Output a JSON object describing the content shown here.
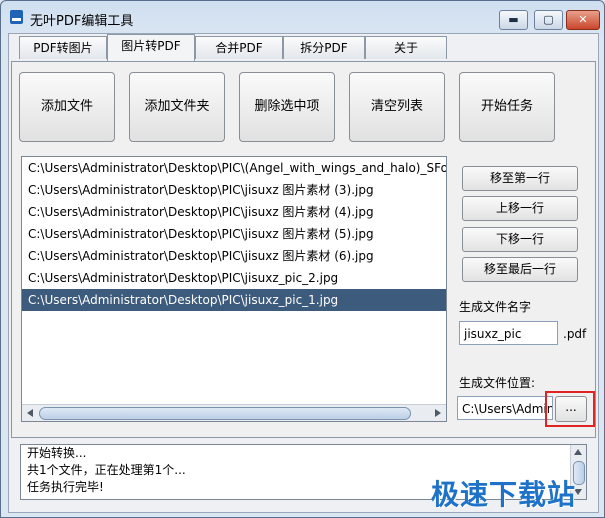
{
  "window": {
    "title": "无叶PDF编辑工具",
    "controls": {
      "minimize": "▬",
      "maximize": "▢",
      "close": "✕"
    }
  },
  "tabs": [
    {
      "label": "PDF转图片"
    },
    {
      "label": "图片转PDF",
      "active": true
    },
    {
      "label": "合并PDF"
    },
    {
      "label": "拆分PDF"
    },
    {
      "label": "关于"
    }
  ],
  "actions": {
    "add_file": "添加文件",
    "add_folder": "添加文件夹",
    "delete_selected": "删除选中项",
    "clear_list": "清空列表",
    "start_task": "开始任务"
  },
  "file_list": [
    "C:\\Users\\Administrator\\Desktop\\PIC\\(Angel_with_wings_and_halo)_SFont.C",
    "C:\\Users\\Administrator\\Desktop\\PIC\\jisuxz 图片素材 (3).jpg",
    "C:\\Users\\Administrator\\Desktop\\PIC\\jisuxz 图片素材 (4).jpg",
    "C:\\Users\\Administrator\\Desktop\\PIC\\jisuxz 图片素材 (5).jpg",
    "C:\\Users\\Administrator\\Desktop\\PIC\\jisuxz 图片素材 (6).jpg",
    "C:\\Users\\Administrator\\Desktop\\PIC\\jisuxz_pic_2.jpg",
    "C:\\Users\\Administrator\\Desktop\\PIC\\jisuxz_pic_1.jpg"
  ],
  "selected_index": 6,
  "order": {
    "move_first": "移至第一行",
    "move_up": "上移一行",
    "move_down": "下移一行",
    "move_last": "移至最后一行"
  },
  "output_name": {
    "label": "生成文件名字",
    "value": "jisuxz_pic",
    "suffix": ".pdf"
  },
  "output_location": {
    "label": "生成文件位置:",
    "value": "C:\\Users\\Admini",
    "browse": "..."
  },
  "log": [
    "开始转换...",
    "共1个文件，正在处理第1个...",
    "任务执行完毕!"
  ],
  "watermark": "极速下载站",
  "colors": {
    "selection": "#3d5b7c",
    "highlight": "#e02424",
    "watermark": "#1e72c8"
  }
}
